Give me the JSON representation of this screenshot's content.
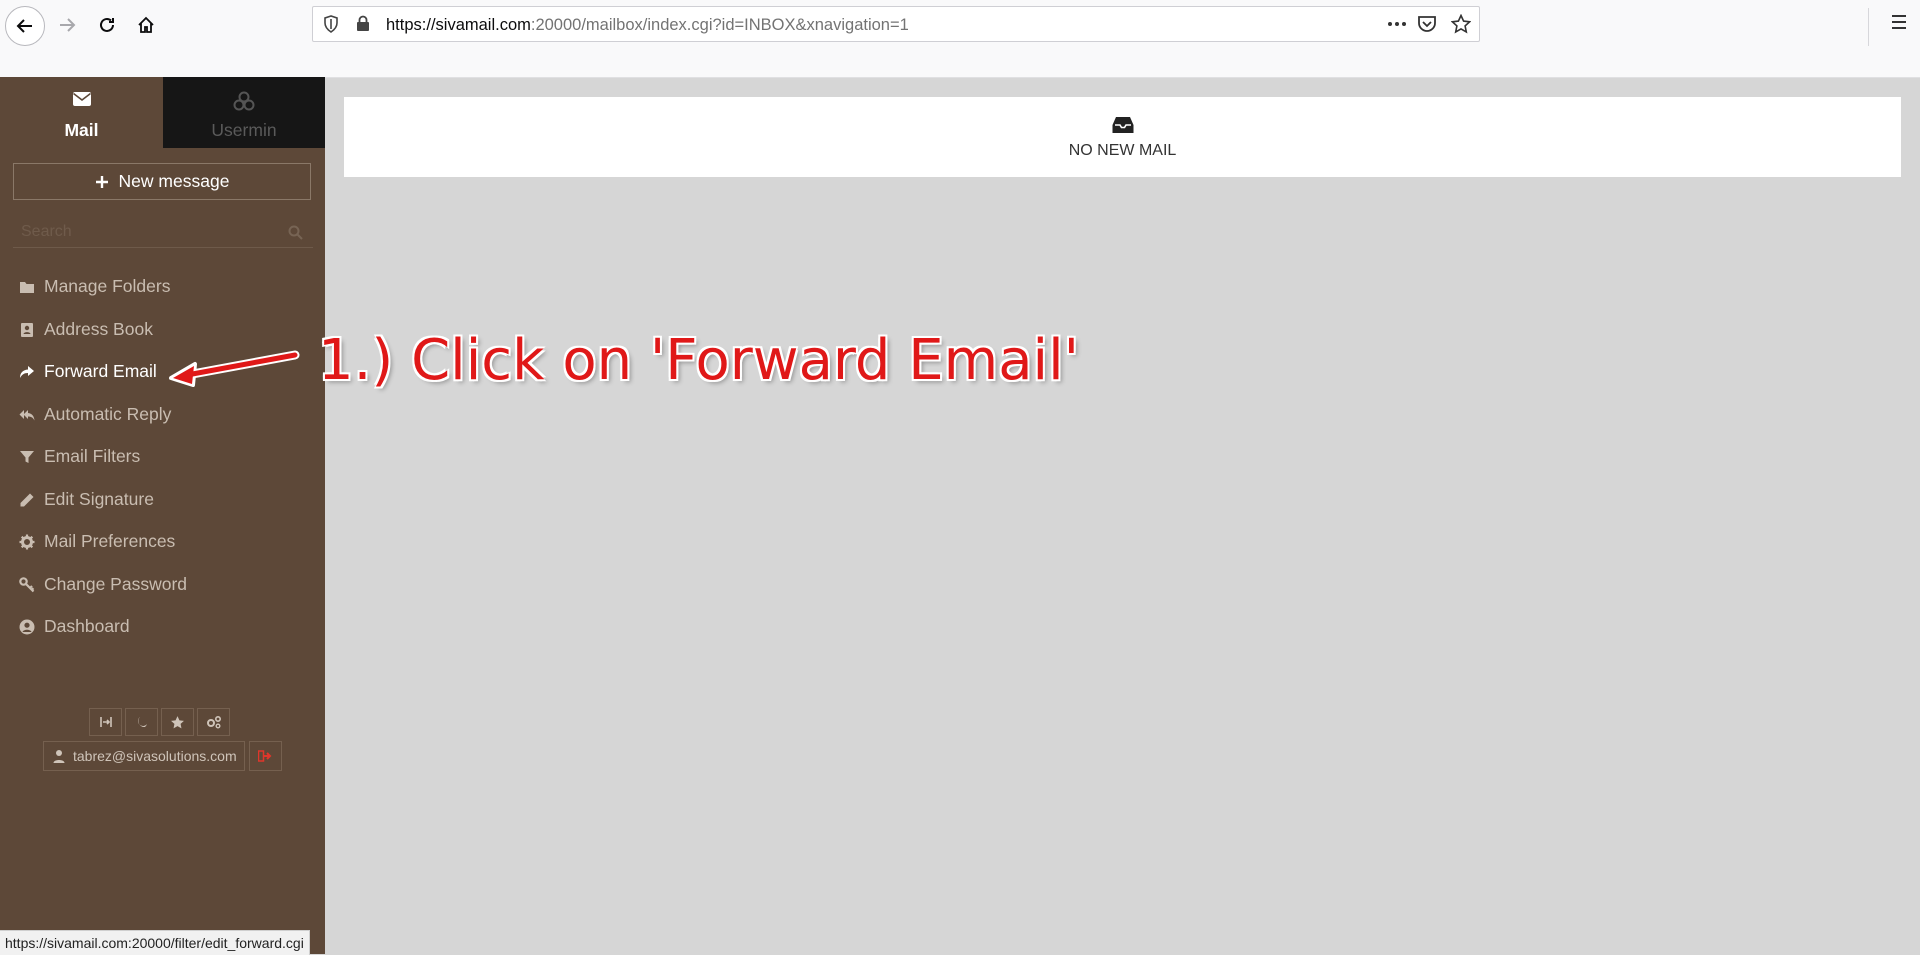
{
  "browser": {
    "url_host": "https://sivamail.com",
    "url_rest": ":20000/mailbox/index.cgi?id=INBOX&xnavigation=1",
    "status_url": "https://sivamail.com:20000/filter/edit_forward.cgi"
  },
  "sidebar": {
    "tabs": [
      {
        "label": "Mail",
        "icon": "envelope-icon",
        "active": true
      },
      {
        "label": "Usermin",
        "icon": "usermin-logo-icon",
        "active": false
      }
    ],
    "new_message_label": "New message",
    "search_placeholder": "Search",
    "menu": [
      {
        "label": "Manage Folders",
        "icon": "folder-icon"
      },
      {
        "label": "Address Book",
        "icon": "address-book-icon"
      },
      {
        "label": "Forward Email",
        "icon": "forward-icon",
        "active": true
      },
      {
        "label": "Automatic Reply",
        "icon": "reply-all-icon"
      },
      {
        "label": "Email Filters",
        "icon": "filter-icon"
      },
      {
        "label": "Edit Signature",
        "icon": "pencil-icon"
      },
      {
        "label": "Mail Preferences",
        "icon": "gear-icon"
      },
      {
        "label": "Change Password",
        "icon": "key-icon"
      },
      {
        "label": "Dashboard",
        "icon": "user-circle-icon"
      }
    ],
    "user_email": "tabrez@sivasolutions.com"
  },
  "main": {
    "empty_label": "NO NEW MAIL"
  },
  "annotation": {
    "text": "1.) Click on 'Forward Email'",
    "color": "#e01818"
  }
}
